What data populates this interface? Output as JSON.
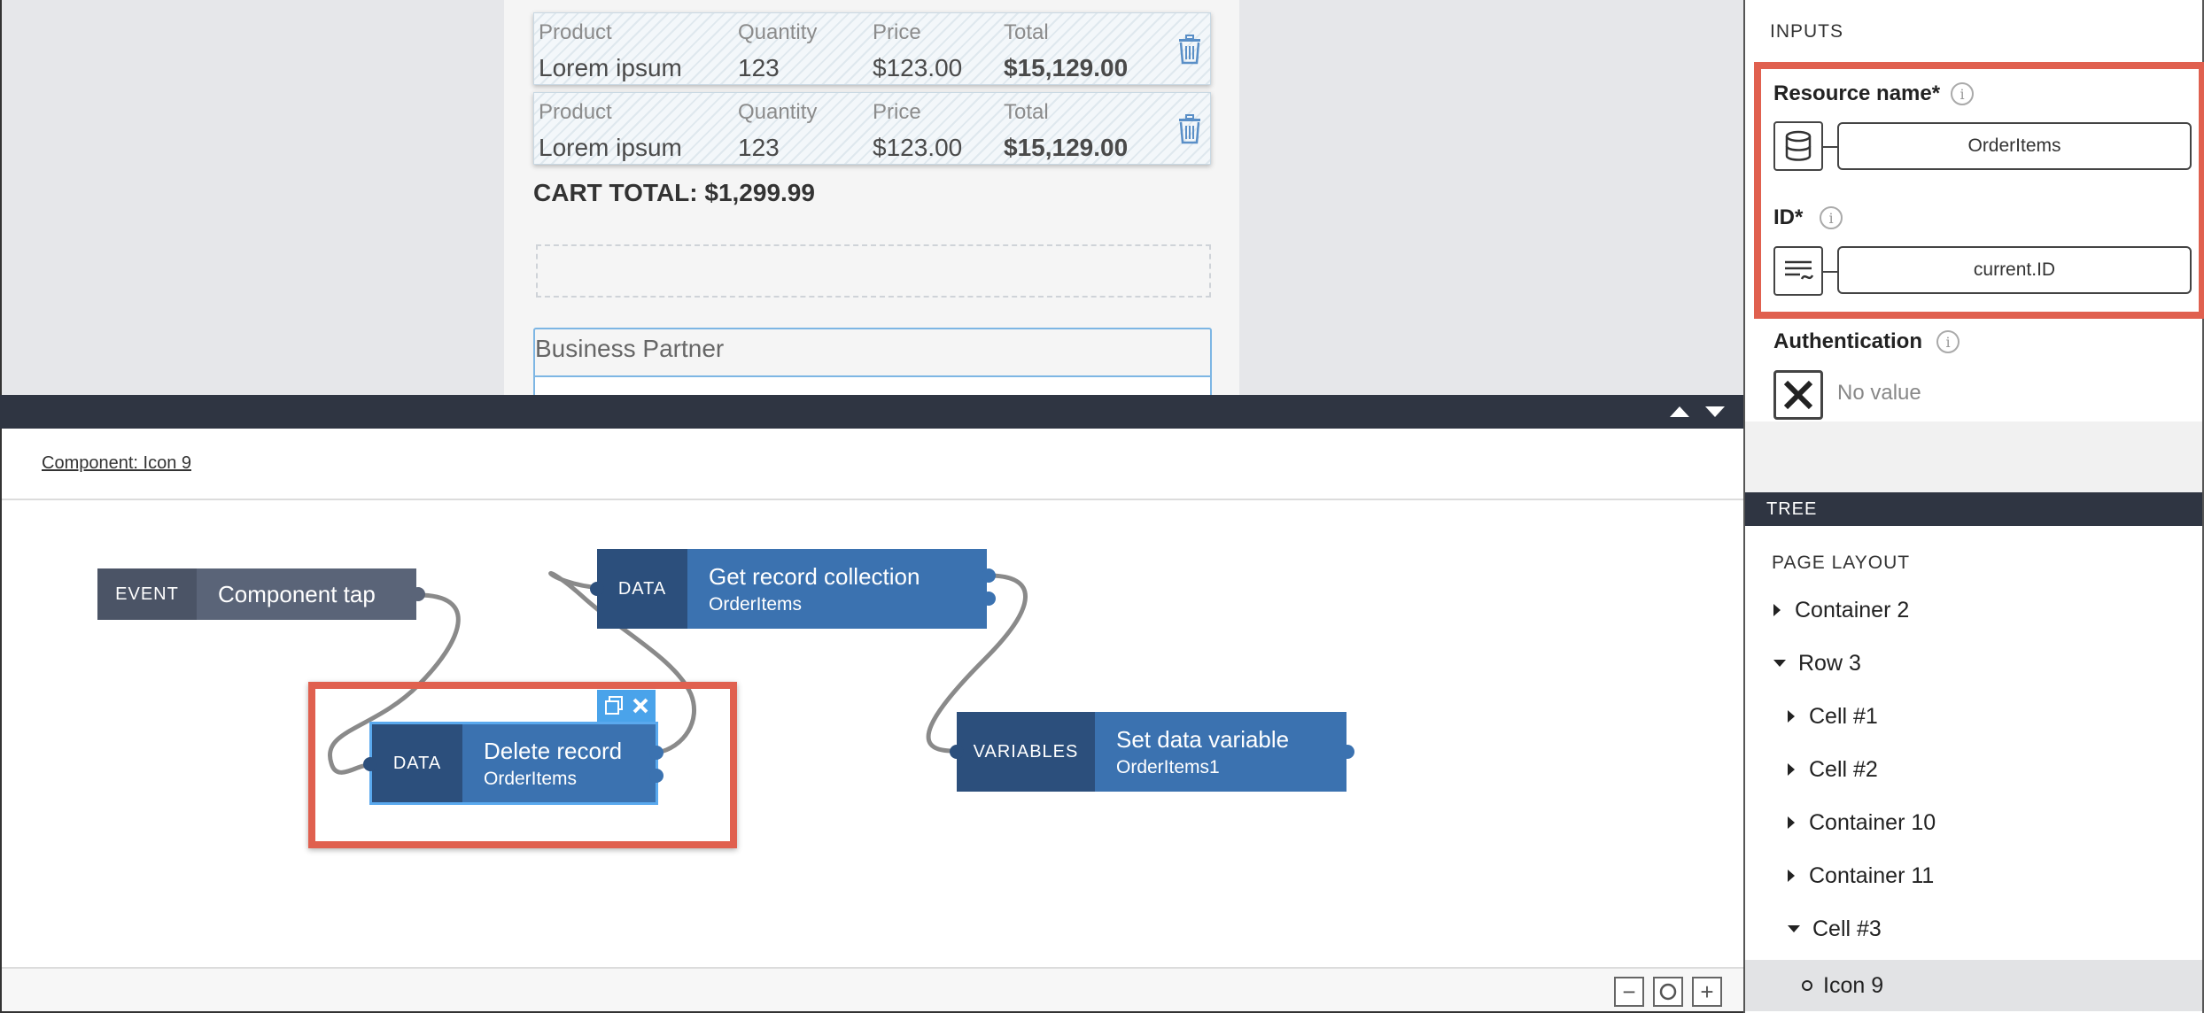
{
  "preview": {
    "cart_headers": [
      "Product",
      "Quantity",
      "Price",
      "Total"
    ],
    "cart_rows": [
      {
        "product": "Lorem ipsum",
        "quantity": "123",
        "price": "$123.00",
        "total": "$15,129.00"
      },
      {
        "product": "Lorem ipsum",
        "quantity": "123",
        "price": "$123.00",
        "total": "$15,129.00"
      }
    ],
    "cart_total": "CART TOTAL: $1,299.99",
    "business_partner_label": "Business Partner"
  },
  "logic": {
    "component_title": "Component: Icon 9",
    "nodes": {
      "event": {
        "tag": "EVENT",
        "title": "Component tap"
      },
      "get_collection": {
        "tag": "DATA",
        "title": "Get record collection",
        "subtitle": "OrderItems"
      },
      "delete_record": {
        "tag": "DATA",
        "title": "Delete record",
        "subtitle": "OrderItems"
      },
      "set_variable": {
        "tag": "VARIABLES",
        "title": "Set data variable",
        "subtitle": "OrderItems1"
      }
    },
    "zoom": {
      "minus": "−",
      "plus": "+"
    }
  },
  "sidebar": {
    "inputs_title": "INPUTS",
    "resource_name": {
      "label": "Resource name*",
      "value": "OrderItems"
    },
    "id": {
      "label": "ID*",
      "value": "current.ID"
    },
    "authentication": {
      "label": "Authentication",
      "value": "No value"
    },
    "info_glyph": "i",
    "tree_title": "TREE",
    "page_layout": "PAGE LAYOUT",
    "tree": [
      {
        "label": "Container 2",
        "state": "collapsed"
      },
      {
        "label": "Row 3",
        "state": "expanded"
      },
      {
        "label": "Cell #1",
        "state": "collapsed"
      },
      {
        "label": "Cell #2",
        "state": "collapsed"
      },
      {
        "label": "Container 10",
        "state": "collapsed"
      },
      {
        "label": "Container 11",
        "state": "collapsed"
      },
      {
        "label": "Cell #3",
        "state": "expanded"
      },
      {
        "label": "Icon 9",
        "state": "leaf"
      }
    ]
  }
}
